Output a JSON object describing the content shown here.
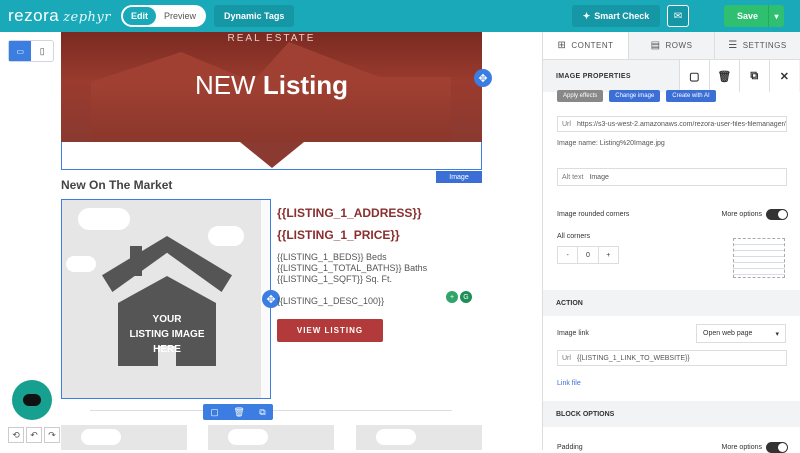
{
  "app": {
    "logo": "rezora",
    "logo_sub": "zephyr",
    "mode_edit": "Edit",
    "mode_preview": "Preview",
    "dynamic_tags": "Dynamic Tags",
    "smart_check": "Smart Check",
    "save": "Save"
  },
  "canvas": {
    "hero_top_text": "REAL ESTATE",
    "hero_heading_light": "NEW",
    "hero_heading_bold": "Listing",
    "image_tag": "Image",
    "section_title": "New On The Market",
    "placeholder_text_1": "YOUR",
    "placeholder_text_2": "LISTING IMAGE",
    "placeholder_text_3": "HERE",
    "address": "{{LISTING_1_ADDRESS}}",
    "price": "{{LISTING_1_PRICE}}",
    "beds": "{{LISTING_1_BEDS}} Beds",
    "baths": "{{LISTING_1_TOTAL_BATHS}} Baths",
    "sqft": "{{LISTING_1_SQFT}} Sq. Ft.",
    "desc": "{{LISTING_1_DESC_100}}",
    "view_button": "VIEW LISTING"
  },
  "panel": {
    "tabs": [
      {
        "label": "CONTENT",
        "icon": "grid-icon"
      },
      {
        "label": "ROWS",
        "icon": "rows-icon"
      },
      {
        "label": "SETTINGS",
        "icon": "settings-icon"
      }
    ],
    "properties_title": "IMAGE PROPERTIES",
    "apply_effects": "Apply effects",
    "change_image": "Change image",
    "create_ai": "Create with AI",
    "url_label": "Url",
    "url_value": "https://s3-us-west-2.amazonaws.com/rezora-user-files-filemanager/",
    "image_name": "Image name: Listing%20Image.jpg",
    "alt_label": "Alt text",
    "alt_value": "Image",
    "rounded_corners": "Image rounded corners",
    "more_options": "More options",
    "all_corners": "All corners",
    "corner_value": "0",
    "minus": "-",
    "plus": "+",
    "action_section": "ACTION",
    "image_link": "Image link",
    "link_select": "Open web page",
    "link_label": "Url",
    "link_value": "{{LISTING_1_LINK_TO_WEBSITE}}",
    "link_file": "Link file",
    "block_options": "BLOCK OPTIONS",
    "padding": "Padding",
    "more_options_2": "More options"
  }
}
